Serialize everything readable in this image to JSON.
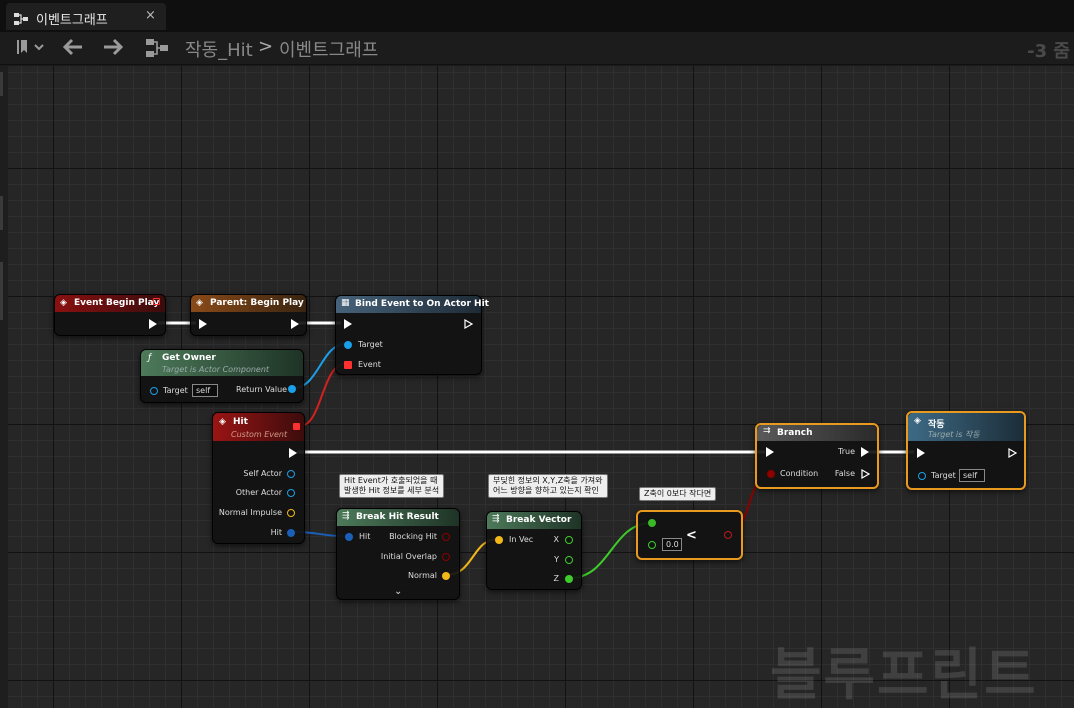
{
  "tab": {
    "title": "이벤트그래프",
    "close": "×"
  },
  "toolbar": {
    "bookmark_icon": "bookmark-icon",
    "back_icon": "arrow-left-icon",
    "forward_icon": "arrow-right-icon",
    "breadcrumb_root": "작동_Hit",
    "breadcrumb_sep": ">",
    "breadcrumb_leaf": "이벤트그래프",
    "zoom": "-3 줌"
  },
  "nodes": {
    "event_begin_play": {
      "title": "Event Begin Play"
    },
    "parent_begin_play": {
      "title": "Parent: Begin Play"
    },
    "bind_event": {
      "title": "Bind Event to On Actor Hit",
      "pin_target": "Target",
      "pin_event": "Event"
    },
    "get_owner": {
      "title": "Get Owner",
      "subtitle": "Target is Actor Component",
      "pin_target": "Target",
      "target_value": "self",
      "pin_return": "Return Value"
    },
    "hit_event": {
      "title": "Hit",
      "subtitle": "Custom Event",
      "pins": [
        "Self Actor",
        "Other Actor",
        "Normal Impulse",
        "Hit"
      ]
    },
    "break_hit_result": {
      "title": "Break Hit Result",
      "pin_hit": "Hit",
      "pins_out": [
        "Blocking Hit",
        "Initial Overlap",
        "Normal"
      ],
      "expand": "⌄"
    },
    "break_vector": {
      "title": "Break Vector",
      "pin_in": "In Vec",
      "pins_out": [
        "X",
        "Y",
        "Z"
      ]
    },
    "less_than": {
      "op": "<",
      "value": "0.0"
    },
    "branch": {
      "title": "Branch",
      "pin_condition": "Condition",
      "pin_true": "True",
      "pin_false": "False"
    },
    "action": {
      "title": "작동",
      "subtitle": "Target is 작동",
      "pin_target": "Target",
      "target_value": "self"
    }
  },
  "comments": {
    "hit_comment": [
      "Hit Event가 호출되었을 때",
      "발생한 Hit 정보를 세부 분석"
    ],
    "vector_comment": [
      "부딪힌 정보의 X,Y,Z축을 가져와",
      "어느 방향을 향하고 있는지 확인"
    ],
    "z_comment": "Z축이 0보다 작다면"
  },
  "watermark": "블루프린트",
  "colors": {
    "exec": "#ffffff",
    "object_pin": "#1aa0e8",
    "struct_pin": "#1b5fb8",
    "delegate_pin": "#ff3030",
    "vector_pin": "#f2b81a",
    "float_pin": "#3ecc2a",
    "bool_pin": "#8c0000",
    "selection": "#e89a1e"
  }
}
